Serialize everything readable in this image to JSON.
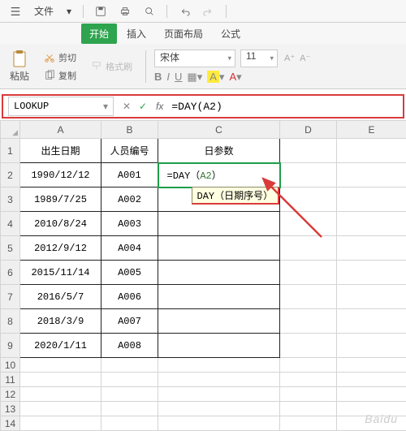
{
  "menubar": {
    "file": "文件",
    "undo_icon": "undo",
    "redo_icon": "redo"
  },
  "ribbon": {
    "tabs": [
      "开始",
      "插入",
      "页面布局",
      "公式"
    ],
    "active_index": 0
  },
  "toolbar": {
    "paste": "粘贴",
    "cut": "剪切",
    "copy": "复制",
    "format_painter": "格式刷",
    "font_name": "宋体",
    "font_size": "11",
    "bold": "B",
    "italic": "I",
    "underline": "U"
  },
  "formula_bar": {
    "name_box": "LOOKUP",
    "cancel": "✕",
    "confirm": "✓",
    "fx": "fx",
    "formula": "=DAY(A2)"
  },
  "sheet": {
    "col_headers": [
      "",
      "A",
      "B",
      "C",
      "D",
      "E"
    ],
    "headers": {
      "A": "出生日期",
      "B": "人员编号",
      "C": "日参数"
    },
    "cell_c2_prefix": "=DAY（",
    "cell_c2_ref": "A2",
    "cell_c2_suffix": "）",
    "tooltip": "DAY（日期序号）",
    "rows": [
      {
        "n": 1,
        "A": "出生日期",
        "B": "人员编号",
        "C": "日参数"
      },
      {
        "n": 2,
        "A": "1990/12/12",
        "B": "A001"
      },
      {
        "n": 3,
        "A": "1989/7/25",
        "B": "A002"
      },
      {
        "n": 4,
        "A": "2010/8/24",
        "B": "A003"
      },
      {
        "n": 5,
        "A": "2012/9/12",
        "B": "A004"
      },
      {
        "n": 6,
        "A": "2015/11/14",
        "B": "A005"
      },
      {
        "n": 7,
        "A": "2016/5/7",
        "B": "A006"
      },
      {
        "n": 8,
        "A": "2018/3/9",
        "B": "A007"
      },
      {
        "n": 9,
        "A": "2020/1/11",
        "B": "A008"
      }
    ],
    "extra_row_numbers": [
      10,
      11,
      12,
      13,
      14
    ]
  },
  "watermark": "Baidu"
}
